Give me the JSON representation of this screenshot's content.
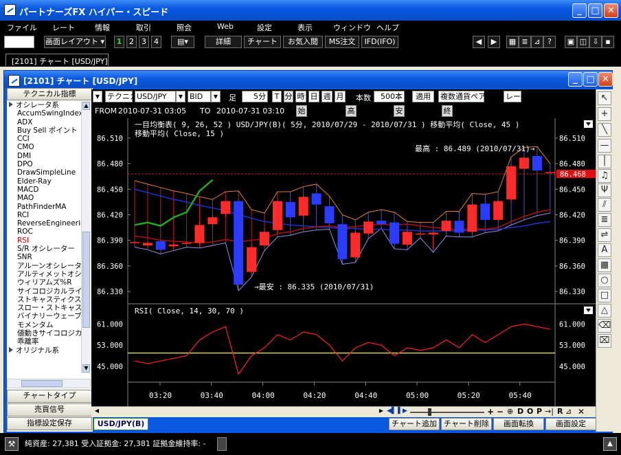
{
  "app": {
    "title": "パートナーズFX ハイパー・スピード"
  },
  "menu": [
    "ファイル",
    "レート",
    "情報",
    "取引",
    "照会",
    "Web",
    "設定",
    "表示",
    "ウィンドウ",
    "ヘルプ"
  ],
  "toolbar": {
    "layout_label": "画面レイアウト",
    "pages": [
      "1",
      "2",
      "3",
      "4"
    ],
    "buttons": [
      "詳細",
      "チャート",
      "お気入閲",
      "MS注文",
      "IFD(IFO)"
    ]
  },
  "doc_tab": "[2101] チャート [USD/JPY]",
  "inner_title": "[2101] チャート [USD/JPY]",
  "left": {
    "header": "テクニカル指標",
    "items": [
      {
        "label": "オシレータ系",
        "group": true
      },
      {
        "label": "AccumSwingIndex"
      },
      {
        "label": "ADX"
      },
      {
        "label": "Buy Sell ポイント"
      },
      {
        "label": "CCI"
      },
      {
        "label": "CMO"
      },
      {
        "label": "DMI"
      },
      {
        "label": "DPO"
      },
      {
        "label": "DrawSimpleLine"
      },
      {
        "label": "Elder-Ray"
      },
      {
        "label": "MACD"
      },
      {
        "label": "MAO"
      },
      {
        "label": "PathFinderMA"
      },
      {
        "label": "RCI"
      },
      {
        "label": "ReverseEngineeringRSI"
      },
      {
        "label": "ROC"
      },
      {
        "label": "RSI",
        "selected": true
      },
      {
        "label": "S/R オシレーター"
      },
      {
        "label": "SNR"
      },
      {
        "label": "アルーンオシレーター"
      },
      {
        "label": "アルティメットオシレーター"
      },
      {
        "label": "ウィリアムズ%R"
      },
      {
        "label": "サイコロジカルライン"
      },
      {
        "label": "ストキャスティクス"
      },
      {
        "label": "スロー・ストキャスティクス"
      },
      {
        "label": "バイナリーウェーブ"
      },
      {
        "label": "モメンタム"
      },
      {
        "label": "値動きサイコロジカル"
      },
      {
        "label": "乖離率"
      },
      {
        "label": "オリジナル系",
        "group": true
      }
    ],
    "chart_type": "チャートタイプ",
    "signal": "売買信号",
    "save": "指標設定保存"
  },
  "controls": {
    "technical": "テクニカル",
    "symbol": "USD/JPY",
    "side": "BID",
    "ashi": "足",
    "period": "5分",
    "t": "T",
    "fun": "分",
    "ji": "時",
    "hi": "日",
    "shu": "週",
    "tsuki": "月",
    "count_label": "本数",
    "count": "500本",
    "apply": "適用",
    "multi": "複数通貨ペア",
    "rate": "レート",
    "from_label": "FROM",
    "from": "2010-07-31  03:05",
    "to_label": "TO",
    "to": "2010-07-31  03:10",
    "open": "始",
    "high": "高",
    "low": "安",
    "close": "終"
  },
  "chart": {
    "legend1": "一目均衡表( 9, 26, 52 )   USD/JPY(B)( 5分, 2010/07/29 - 2010/07/31 )   移動平均( Close, 45 )",
    "legend2": "移動平均( Close, 15 )",
    "high_note": "最高 : 86.489 (2010/07/31)→",
    "low_note": "→最安 : 86.335 (2010/07/31)",
    "price_ticks": [
      "86.510",
      "86.480",
      "86.450",
      "86.420",
      "86.390",
      "86.360",
      "86.330"
    ],
    "current_price": "86.468",
    "rsi_legend": "RSI( Close, 14, 30, 70 )",
    "rsi_ticks": [
      "61.000",
      "53.000",
      "45.000"
    ],
    "time_ticks": [
      "03:20",
      "03:40",
      "04:00",
      "04:20",
      "04:40",
      "05:00",
      "05:20",
      "05:40"
    ],
    "colors": {
      "up": "#ff2a2a",
      "down": "#2a3cff",
      "ma15": "#b01010",
      "ma45": "#2233cc",
      "cloud": "#e08040",
      "chikou": "#22aa22",
      "rsi": "#ff2020",
      "rsi_mid": "#d8d060"
    }
  },
  "chart_data": {
    "type": "candlestick",
    "price_ylim": [
      86.322,
      86.522
    ],
    "rsi_ylim": [
      40,
      64
    ],
    "candles": [
      {
        "o": 86.387,
        "h": 86.389,
        "l": 86.386,
        "c": 86.388
      },
      {
        "o": 86.384,
        "h": 86.388,
        "l": 86.383,
        "c": 86.387
      },
      {
        "o": 86.389,
        "h": 86.39,
        "l": 86.378,
        "c": 86.379
      },
      {
        "o": 86.383,
        "h": 86.387,
        "l": 86.382,
        "c": 86.385
      },
      {
        "o": 86.387,
        "h": 86.388,
        "l": 86.386,
        "c": 86.387
      },
      {
        "o": 86.387,
        "h": 86.412,
        "l": 86.385,
        "c": 86.408
      },
      {
        "o": 86.409,
        "h": 86.419,
        "l": 86.405,
        "c": 86.417
      },
      {
        "o": 86.421,
        "h": 86.437,
        "l": 86.418,
        "c": 86.436
      },
      {
        "o": 86.436,
        "h": 86.438,
        "l": 86.335,
        "c": 86.338
      },
      {
        "o": 86.353,
        "h": 86.385,
        "l": 86.351,
        "c": 86.382
      },
      {
        "o": 86.384,
        "h": 86.403,
        "l": 86.382,
        "c": 86.4
      },
      {
        "o": 86.402,
        "h": 86.437,
        "l": 86.398,
        "c": 86.436
      },
      {
        "o": 86.435,
        "h": 86.437,
        "l": 86.416,
        "c": 86.417
      },
      {
        "o": 86.419,
        "h": 86.443,
        "l": 86.417,
        "c": 86.441
      },
      {
        "o": 86.445,
        "h": 86.446,
        "l": 86.431,
        "c": 86.432
      },
      {
        "o": 86.43,
        "h": 86.432,
        "l": 86.409,
        "c": 86.41
      },
      {
        "o": 86.409,
        "h": 86.41,
        "l": 86.366,
        "c": 86.368
      },
      {
        "o": 86.37,
        "h": 86.401,
        "l": 86.368,
        "c": 86.399
      },
      {
        "o": 86.398,
        "h": 86.413,
        "l": 86.396,
        "c": 86.412
      },
      {
        "o": 86.413,
        "h": 86.416,
        "l": 86.408,
        "c": 86.409
      },
      {
        "o": 86.411,
        "h": 86.413,
        "l": 86.384,
        "c": 86.386
      },
      {
        "o": 86.385,
        "h": 86.402,
        "l": 86.383,
        "c": 86.4
      },
      {
        "o": 86.398,
        "h": 86.399,
        "l": 86.397,
        "c": 86.398
      },
      {
        "o": 86.397,
        "h": 86.4,
        "l": 86.38,
        "c": 86.399
      },
      {
        "o": 86.401,
        "h": 86.414,
        "l": 86.399,
        "c": 86.413
      },
      {
        "o": 86.413,
        "h": 86.414,
        "l": 86.398,
        "c": 86.399
      },
      {
        "o": 86.4,
        "h": 86.435,
        "l": 86.398,
        "c": 86.432
      },
      {
        "o": 86.433,
        "h": 86.434,
        "l": 86.413,
        "c": 86.414
      },
      {
        "o": 86.414,
        "h": 86.437,
        "l": 86.412,
        "c": 86.436
      },
      {
        "o": 86.438,
        "h": 86.478,
        "l": 86.436,
        "c": 86.477
      },
      {
        "o": 86.474,
        "h": 86.489,
        "l": 86.473,
        "c": 86.487
      },
      {
        "o": 86.489,
        "h": 86.49,
        "l": 86.471,
        "c": 86.472
      },
      {
        "o": 86.47,
        "h": 86.47,
        "l": 86.469,
        "c": 86.47
      }
    ],
    "ma15": [
      86.395,
      86.393,
      86.39,
      86.389,
      86.388,
      86.387,
      86.388,
      86.391,
      86.388,
      86.39,
      86.392,
      86.398,
      86.4,
      86.404,
      86.406,
      86.407,
      86.405,
      86.406,
      86.408,
      86.409,
      86.408,
      86.409,
      86.407,
      86.405,
      86.404,
      86.402,
      86.404,
      86.403,
      86.405,
      86.412,
      86.418,
      86.423,
      86.426
    ],
    "ma45": [
      86.45,
      86.446,
      86.442,
      86.438,
      86.435,
      86.431,
      86.428,
      86.425,
      86.42,
      86.416,
      86.412,
      86.41,
      86.408,
      86.407,
      86.406,
      86.405,
      86.404,
      86.404,
      86.403,
      86.403,
      86.402,
      86.402,
      86.401,
      86.401,
      86.401,
      86.401,
      86.402,
      86.402,
      86.403,
      86.405,
      86.407,
      86.41,
      86.412
    ],
    "rsi": [
      47,
      46,
      47,
      48,
      49,
      55,
      58,
      60,
      42,
      49,
      52,
      57,
      55,
      58,
      57,
      53,
      47,
      52,
      54,
      53,
      49,
      52,
      51,
      52,
      55,
      52,
      57,
      54,
      57,
      60,
      61,
      60,
      59
    ],
    "rsi_level": 50
  },
  "bottom": {
    "series_tab": "USD/JPY(B)",
    "add": "チャート追加",
    "del": "チャート削除",
    "switch": "画面転換",
    "settings": "画面設定",
    "scroll_letters": [
      "D",
      "O",
      "P",
      "R"
    ]
  },
  "status": {
    "text": "純資産: 27,381  受入証拠金: 27,381  証拠金維持率: -"
  }
}
